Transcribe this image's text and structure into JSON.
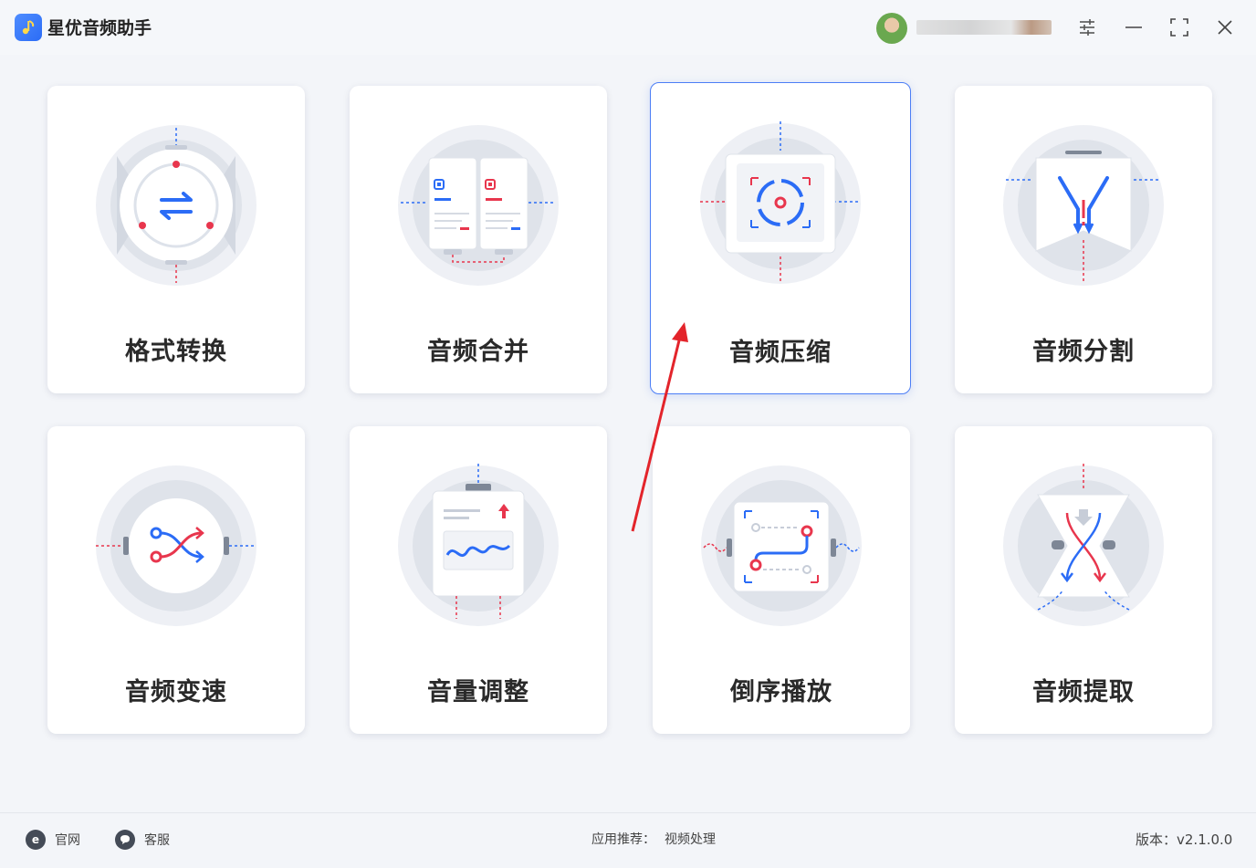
{
  "app": {
    "title": "星优音频助手"
  },
  "cards": [
    {
      "label": "格式转换"
    },
    {
      "label": "音频合并"
    },
    {
      "label": "音频压缩"
    },
    {
      "label": "音频分割"
    },
    {
      "label": "音频变速"
    },
    {
      "label": "音量调整"
    },
    {
      "label": "倒序播放"
    },
    {
      "label": "音频提取"
    }
  ],
  "footer": {
    "website": "官网",
    "support": "客服",
    "recommend_label": "应用推荐：",
    "recommend_link": "视频处理",
    "version": "版本：v2.1.0.0"
  },
  "colors": {
    "accent": "#2b6cf6",
    "red": "#e8364d",
    "selected_border": "#4c7ef6"
  }
}
